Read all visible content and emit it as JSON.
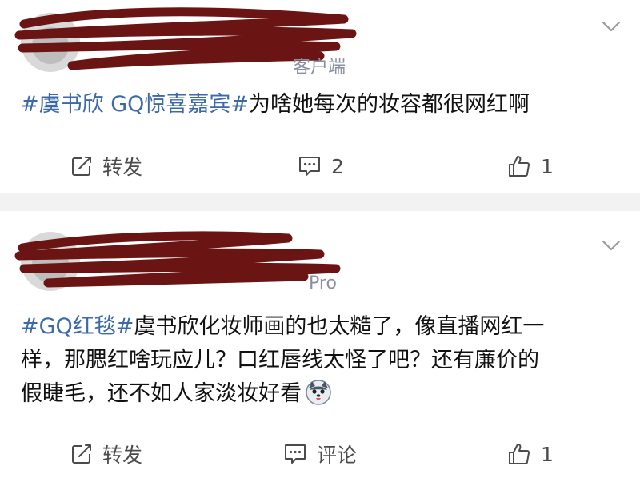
{
  "posts": [
    {
      "source_text": "客户端",
      "topic": "#虞书欣 GQ惊喜嘉宾#",
      "body": "为啥她每次的妆容都很网红啊",
      "actions": {
        "repost_label": "转发",
        "comment_label": "2",
        "like_count": "1"
      }
    },
    {
      "source_text": "Pro",
      "topic": "#GQ红毯#",
      "body_lines": [
        "虞书欣化妆师画的也太糙了，像直播网红一",
        "样，那腮红啥玩应儿？口红唇线太怪了吧？还有廉价的",
        "假睫毛，还不如人家淡妆好看"
      ],
      "actions": {
        "repost_label": "转发",
        "comment_label": "评论",
        "like_count": "1"
      }
    }
  ],
  "colors": {
    "topic": "#3c6aa8",
    "scribble": "#6b1414",
    "separator": "#f2f2f2",
    "icon": "#4b4b4b"
  },
  "icons": [
    "repost-icon",
    "comment-icon",
    "like-icon",
    "chevron-down-icon",
    "dog-emoji-icon"
  ]
}
